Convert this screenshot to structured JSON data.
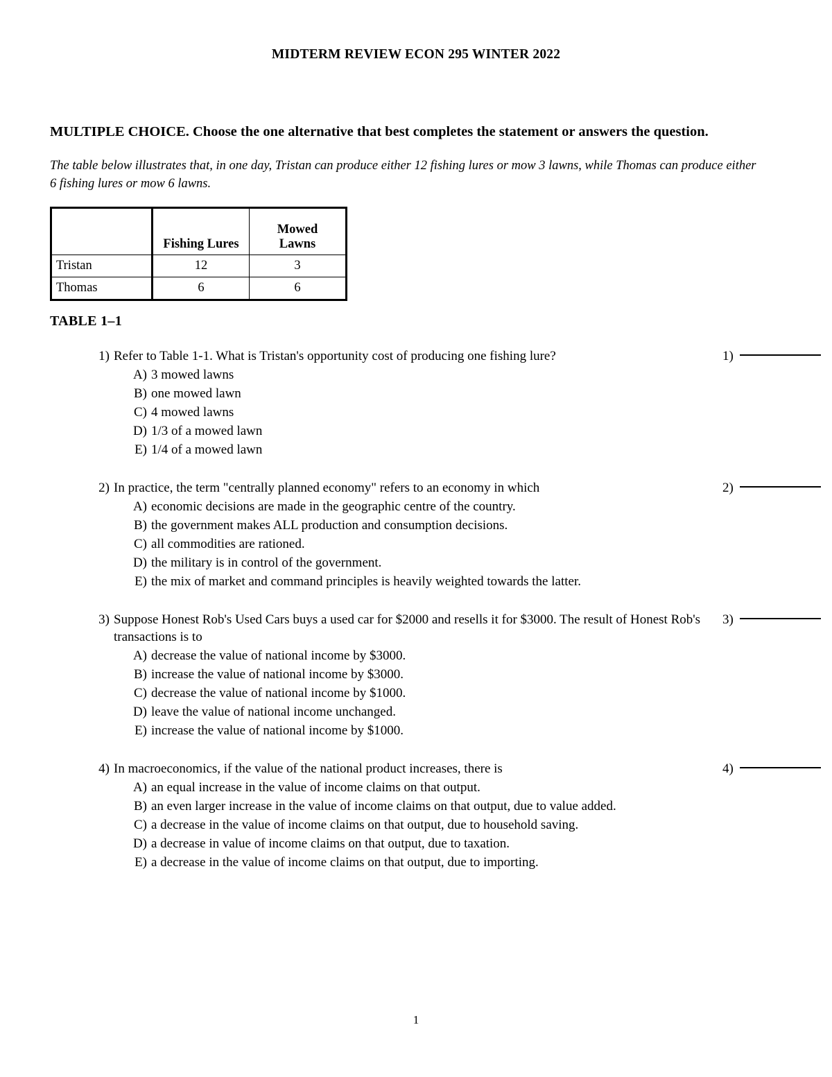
{
  "document": {
    "running_head": "MIDTERM REVIEW ECON 295 WINTER 2022",
    "page_number": "1"
  },
  "instruction": "MULTIPLE CHOICE.  Choose the one alternative that best completes the statement or answers the question.",
  "intro_paragraph": "The table below illustrates that, in one day, Tristan can produce either 12 fishing lures or mow 3 lawns, while Thomas can produce either 6 fishing lures or mow 6 lawns.",
  "table": {
    "caption": "TABLE 1–1",
    "headers": [
      "",
      "Fishing Lures",
      "Mowed Lawns"
    ],
    "header_lines": {
      "col2": "Fishing Lures",
      "col3_line1": "Mowed",
      "col3_line2": "Lawns"
    },
    "rows": [
      {
        "label": "Tristan",
        "fishing_lures": "12",
        "mowed_lawns": "3"
      },
      {
        "label": "Thomas",
        "fishing_lures": "6",
        "mowed_lawns": "6"
      }
    ]
  },
  "questions": [
    {
      "number": "1)",
      "answer_number": "1)",
      "stem": "Refer to Table 1-1. What is Tristan's opportunity cost of producing one fishing lure?",
      "options": [
        {
          "letter": "A)",
          "text": "3 mowed lawns"
        },
        {
          "letter": "B)",
          "text": "one mowed lawn"
        },
        {
          "letter": "C)",
          "text": "4 mowed lawns"
        },
        {
          "letter": "D)",
          "text": "1/3 of a mowed lawn"
        },
        {
          "letter": "E)",
          "text": "1/4 of a mowed lawn"
        }
      ]
    },
    {
      "number": "2)",
      "answer_number": "2)",
      "stem": "In practice, the term \"centrally planned economy\" refers to an economy in which",
      "options": [
        {
          "letter": "A)",
          "text": "economic decisions are made in the geographic centre of the country."
        },
        {
          "letter": "B)",
          "text": "the government makes ALL production and consumption decisions."
        },
        {
          "letter": "C)",
          "text": "all commodities are rationed."
        },
        {
          "letter": "D)",
          "text": "the military is in control of the government."
        },
        {
          "letter": "E)",
          "text": "the mix of market and command principles is heavily weighted towards the latter."
        }
      ]
    },
    {
      "number": "3)",
      "answer_number": "3)",
      "stem": "Suppose Honest Rob's Used Cars buys a used car for $2000 and resells it for $3000. The result of Honest Rob's transactions is to",
      "options": [
        {
          "letter": "A)",
          "text": "decrease the value of national income by $3000."
        },
        {
          "letter": "B)",
          "text": "increase the value of national income by $3000."
        },
        {
          "letter": "C)",
          "text": "decrease the value of national income by $1000."
        },
        {
          "letter": "D)",
          "text": "leave the value of national income unchanged."
        },
        {
          "letter": "E)",
          "text": "increase the value of national income by $1000."
        }
      ]
    },
    {
      "number": "4)",
      "answer_number": "4)",
      "stem": "In macroeconomics, if the value of the national product increases, there is",
      "options": [
        {
          "letter": "A)",
          "text": "an equal increase in the value of income claims on that output."
        },
        {
          "letter": "B)",
          "text": "an even larger increase in the value of income claims on that output, due to value added."
        },
        {
          "letter": "C)",
          "text": "a decrease in the value of income claims on that output, due to household saving."
        },
        {
          "letter": "D)",
          "text": "a decrease in value of income claims on that output, due to taxation."
        },
        {
          "letter": "E)",
          "text": "a decrease in the value of income claims on that output, due to importing."
        }
      ]
    }
  ]
}
